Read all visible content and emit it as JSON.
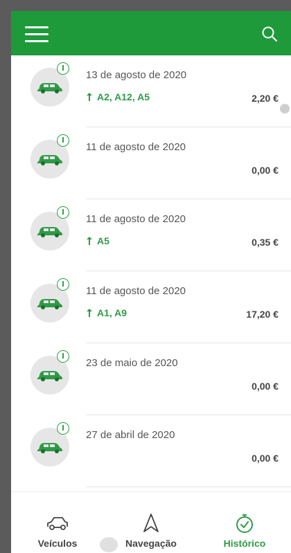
{
  "header": {
    "menu_icon": "hamburger-menu-icon",
    "search_icon": "search-icon",
    "color": "#1e9a3a"
  },
  "history": [
    {
      "date": "13 de agosto de 2020",
      "roads": "A2, A12, A5",
      "amount": "2,20 €"
    },
    {
      "date": "11 de agosto de 2020",
      "roads": "",
      "amount": "0,00 €"
    },
    {
      "date": "11 de agosto de 2020",
      "roads": "A5",
      "amount": "0,35 €"
    },
    {
      "date": "11 de agosto de 2020",
      "roads": "A1, A9",
      "amount": "17,20 €"
    },
    {
      "date": "23 de maio de 2020",
      "roads": "",
      "amount": "0,00 €"
    },
    {
      "date": "27 de abril de 2020",
      "roads": "",
      "amount": "0,00 €"
    }
  ],
  "bottom_nav": [
    {
      "label": "Veículos",
      "icon": "car-outline-icon",
      "active": false
    },
    {
      "label": "Navegação",
      "icon": "navigation-arrow-icon",
      "active": false
    },
    {
      "label": "Histórico",
      "icon": "history-timer-icon",
      "active": true
    }
  ],
  "accent_color": "#2e9b47"
}
